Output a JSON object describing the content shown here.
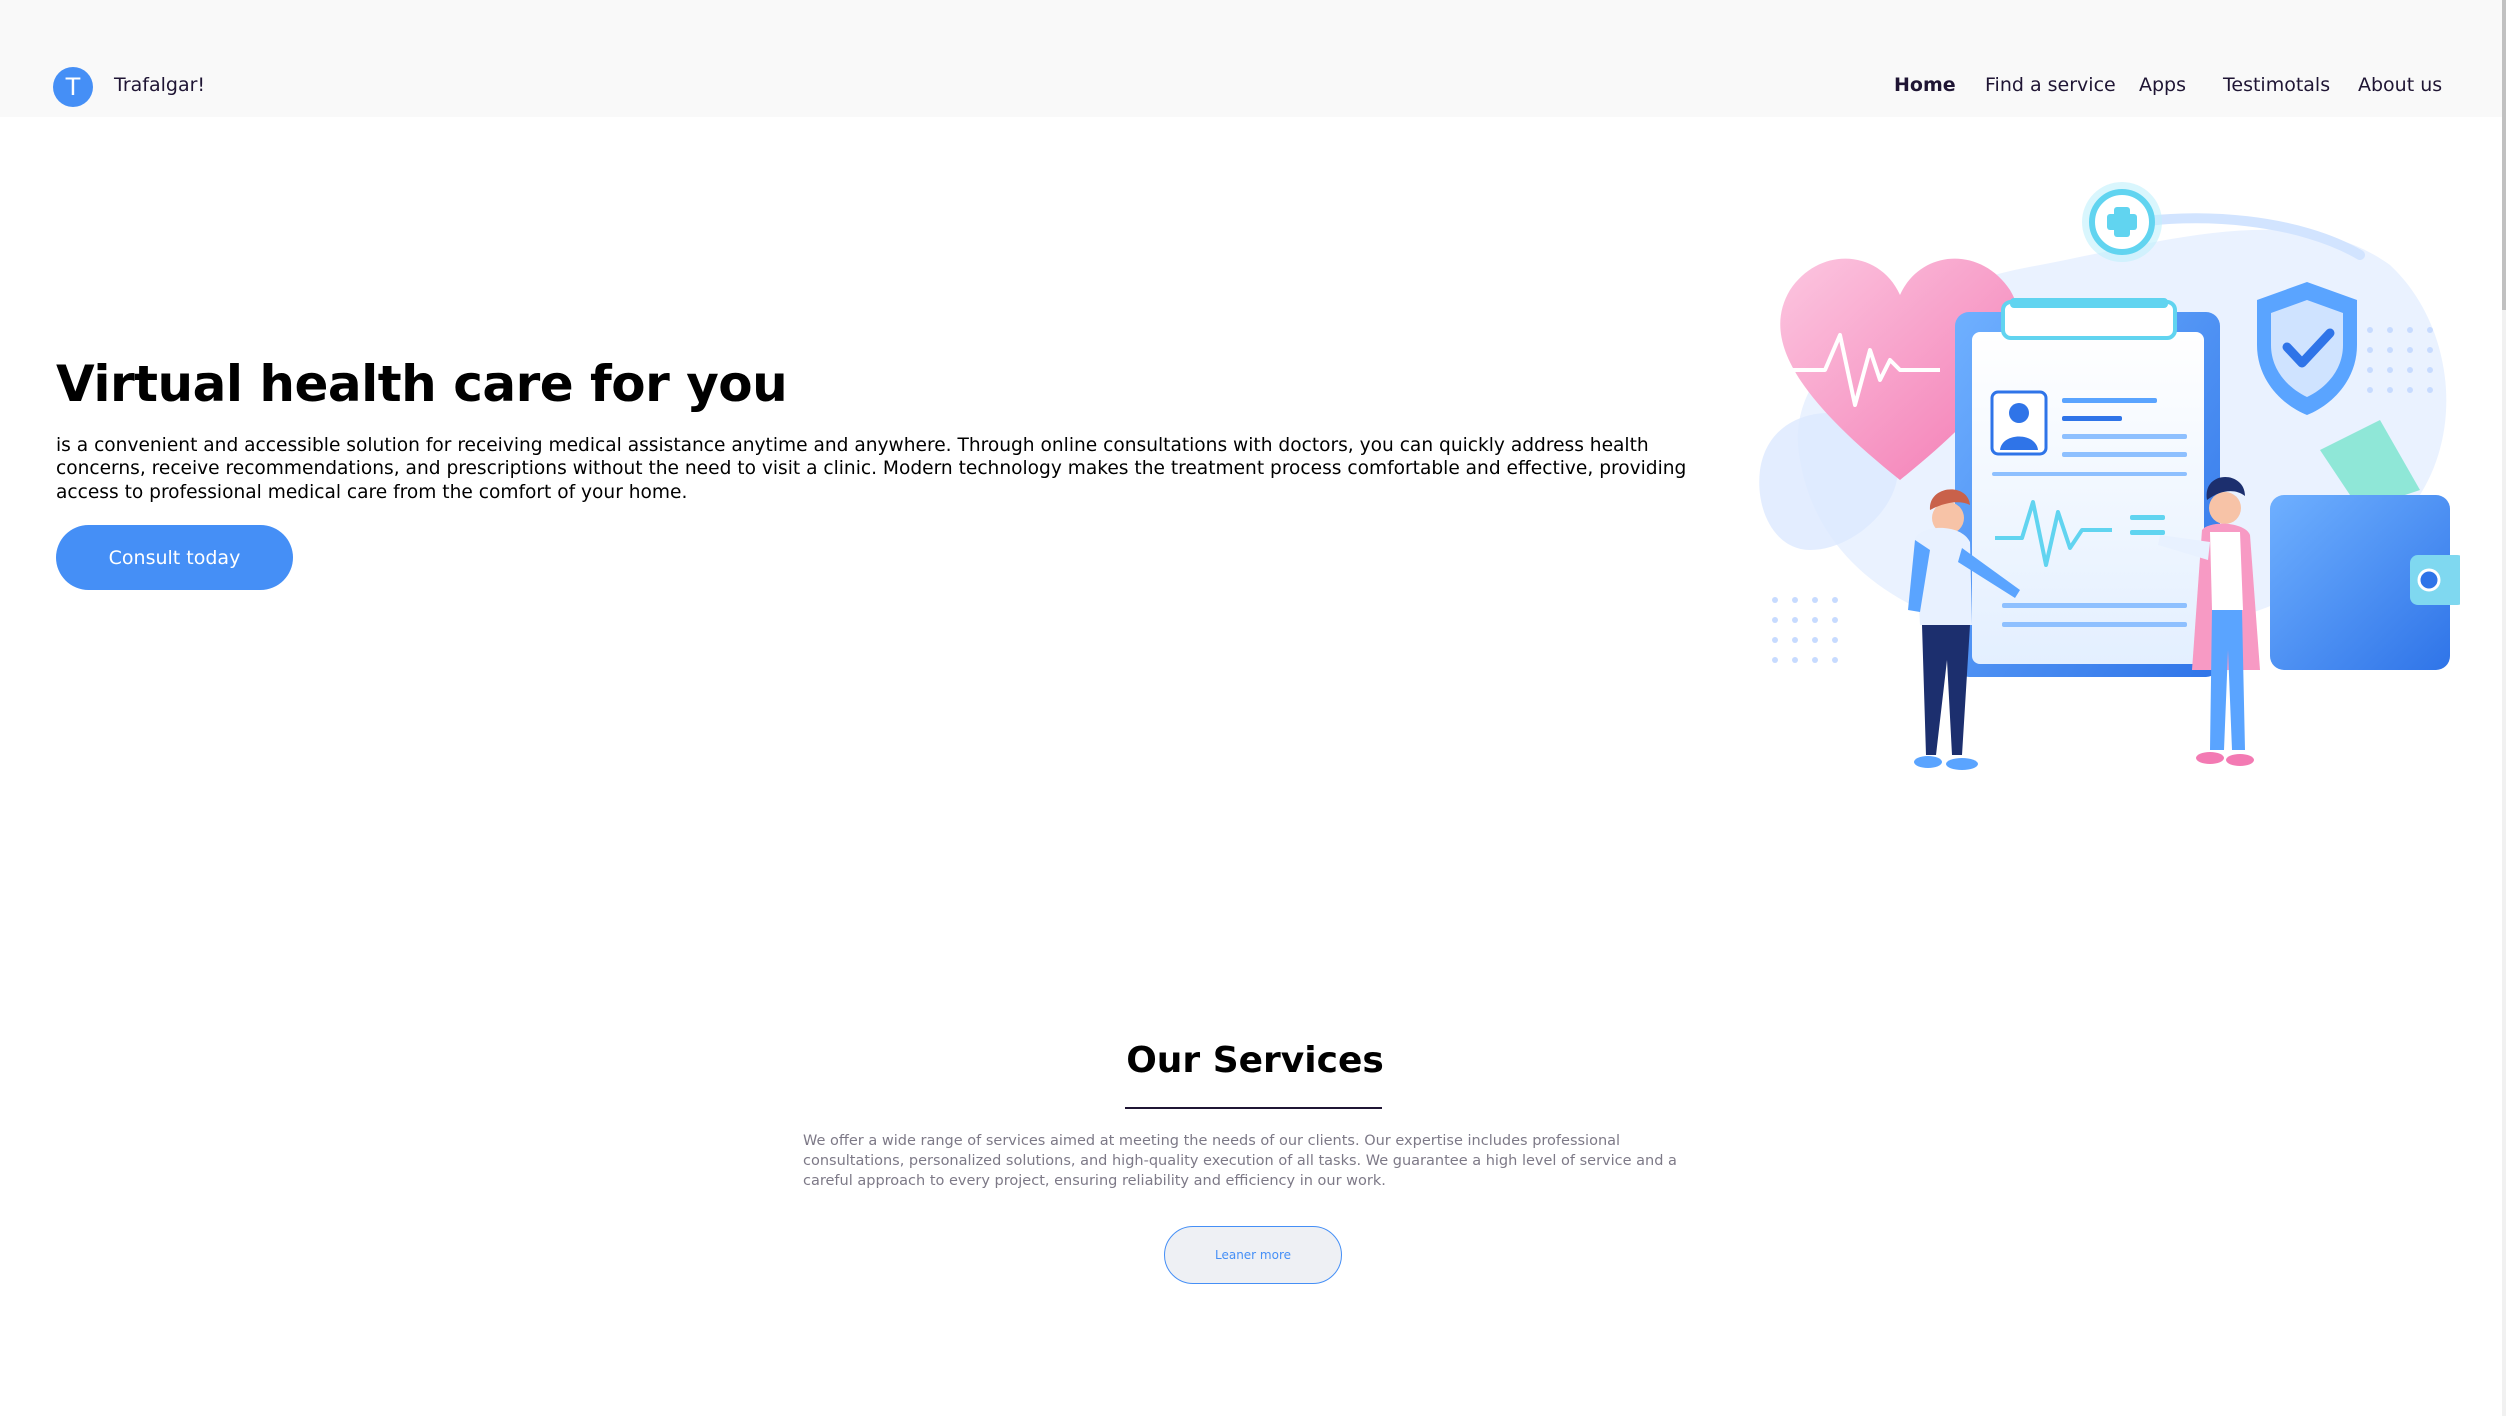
{
  "header": {
    "logo_letter": "T",
    "brand": "Trafalgar!",
    "nav": [
      {
        "label": "Home",
        "active": true
      },
      {
        "label": "Find a service",
        "active": false
      },
      {
        "label": "Apps",
        "active": false
      },
      {
        "label": "Testimotals",
        "active": false
      },
      {
        "label": "About us",
        "active": false
      }
    ]
  },
  "hero": {
    "title": "Virtual health care for you",
    "description": "is a convenient and accessible solution for receiving medical assistance anytime and anywhere. Through online consultations with doctors, you can quickly address health concerns, receive recommendations, and prescriptions without the need to visit a clinic. Modern technology makes the treatment process comfortable and effective, providing access to professional medical care from the comfort of your home.",
    "cta_label": "Consult today"
  },
  "services": {
    "title": "Our Services",
    "description": "We offer a wide range of services aimed at meeting the needs of our clients. Our expertise includes professional consultations, personalized solutions, and high-quality execution of all tasks. We guarantee a high level of service and a careful approach to every project, ensuring reliability and efficiency in our work.",
    "button_label": "Leaner more"
  },
  "colors": {
    "accent": "#458ff6",
    "header_bg": "#f9f9f9",
    "heart_pink": "#f79ac4",
    "muted_text": "#7d7987"
  },
  "icons": [
    "heart-icon",
    "plus-badge-icon",
    "shield-check-icon",
    "wallet-icon",
    "clipboard-icon"
  ]
}
